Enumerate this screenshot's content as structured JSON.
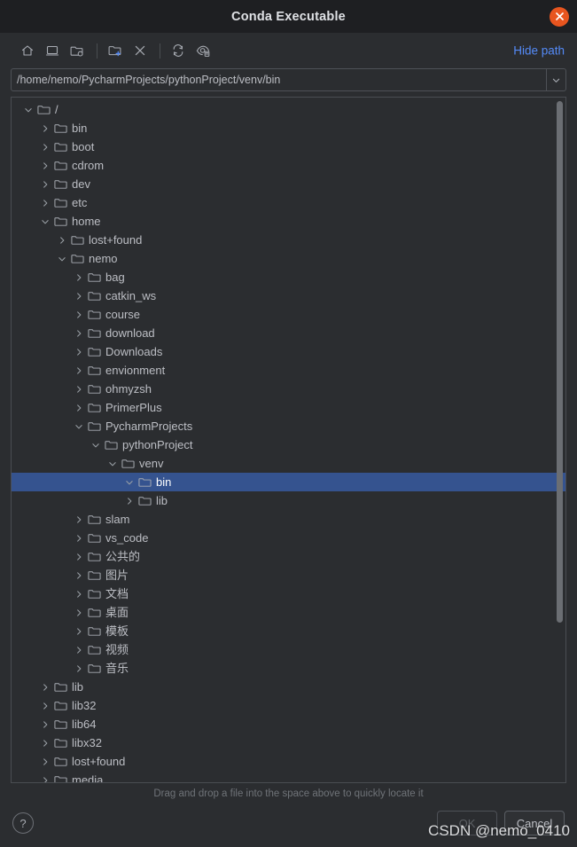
{
  "window": {
    "title": "Conda Executable",
    "close_label": "×"
  },
  "toolbar": {
    "buttons": [
      {
        "name": "home-icon",
        "tooltip": "Home"
      },
      {
        "name": "desktop-icon",
        "tooltip": "Desktop"
      },
      {
        "name": "project-folder-icon",
        "tooltip": "Project Directory"
      },
      {
        "name": "new-folder-icon",
        "tooltip": "New Folder"
      },
      {
        "name": "delete-icon",
        "tooltip": "Delete"
      },
      {
        "name": "refresh-icon",
        "tooltip": "Refresh"
      },
      {
        "name": "show-hidden-files-icon",
        "tooltip": "Show Hidden Files"
      }
    ],
    "hide_path_label": "Hide path"
  },
  "path_field": {
    "value": "/home/nemo/PycharmProjects/pythonProject/venv/bin",
    "placeholder": "",
    "dropdown_icon": "chevron-down-icon"
  },
  "tree": {
    "rows": [
      {
        "label": "/",
        "depth": 0,
        "state": "expanded"
      },
      {
        "label": "bin",
        "depth": 1,
        "state": "collapsed"
      },
      {
        "label": "boot",
        "depth": 1,
        "state": "collapsed"
      },
      {
        "label": "cdrom",
        "depth": 1,
        "state": "collapsed"
      },
      {
        "label": "dev",
        "depth": 1,
        "state": "collapsed"
      },
      {
        "label": "etc",
        "depth": 1,
        "state": "collapsed"
      },
      {
        "label": "home",
        "depth": 1,
        "state": "expanded"
      },
      {
        "label": "lost+found",
        "depth": 2,
        "state": "collapsed"
      },
      {
        "label": "nemo",
        "depth": 2,
        "state": "expanded"
      },
      {
        "label": "bag",
        "depth": 3,
        "state": "collapsed"
      },
      {
        "label": "catkin_ws",
        "depth": 3,
        "state": "collapsed"
      },
      {
        "label": "course",
        "depth": 3,
        "state": "collapsed"
      },
      {
        "label": "download",
        "depth": 3,
        "state": "collapsed"
      },
      {
        "label": "Downloads",
        "depth": 3,
        "state": "collapsed"
      },
      {
        "label": "envionment",
        "depth": 3,
        "state": "collapsed"
      },
      {
        "label": "ohmyzsh",
        "depth": 3,
        "state": "collapsed"
      },
      {
        "label": "PrimerPlus",
        "depth": 3,
        "state": "collapsed"
      },
      {
        "label": "PycharmProjects",
        "depth": 3,
        "state": "expanded"
      },
      {
        "label": "pythonProject",
        "depth": 4,
        "state": "expanded"
      },
      {
        "label": "venv",
        "depth": 5,
        "state": "expanded"
      },
      {
        "label": "bin",
        "depth": 6,
        "state": "expanded",
        "selected": true
      },
      {
        "label": "lib",
        "depth": 6,
        "state": "collapsed"
      },
      {
        "label": "slam",
        "depth": 3,
        "state": "collapsed"
      },
      {
        "label": "vs_code",
        "depth": 3,
        "state": "collapsed"
      },
      {
        "label": "公共的",
        "depth": 3,
        "state": "collapsed"
      },
      {
        "label": "图片",
        "depth": 3,
        "state": "collapsed"
      },
      {
        "label": "文档",
        "depth": 3,
        "state": "collapsed"
      },
      {
        "label": "桌面",
        "depth": 3,
        "state": "collapsed"
      },
      {
        "label": "模板",
        "depth": 3,
        "state": "collapsed"
      },
      {
        "label": "视频",
        "depth": 3,
        "state": "collapsed"
      },
      {
        "label": "音乐",
        "depth": 3,
        "state": "collapsed"
      },
      {
        "label": "lib",
        "depth": 1,
        "state": "collapsed"
      },
      {
        "label": "lib32",
        "depth": 1,
        "state": "collapsed"
      },
      {
        "label": "lib64",
        "depth": 1,
        "state": "collapsed"
      },
      {
        "label": "libx32",
        "depth": 1,
        "state": "collapsed"
      },
      {
        "label": "lost+found",
        "depth": 1,
        "state": "collapsed"
      },
      {
        "label": "media",
        "depth": 1,
        "state": "collapsed"
      },
      {
        "label": "",
        "depth": 1,
        "state": "collapsed"
      }
    ]
  },
  "hint": {
    "text": "Drag and drop a file into the space above to quickly locate it"
  },
  "footer": {
    "help_label": "?",
    "ok_label": "OK",
    "cancel_label": "Cancel"
  },
  "watermark": {
    "text": "CSDN @nemo_0410"
  },
  "colors": {
    "window_bg": "#2b2d30",
    "titlebar_bg": "#1e1f22",
    "selection": "#35538f",
    "accent_link": "#548af7",
    "close_button": "#e8551f",
    "text": "#bcbec4",
    "hint_text": "#6f7378"
  }
}
